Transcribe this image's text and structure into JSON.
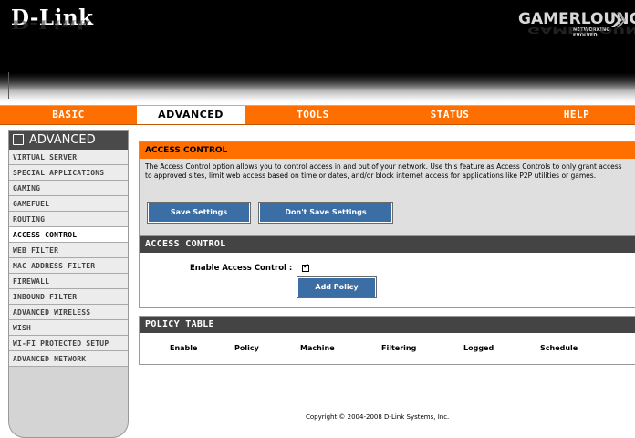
{
  "header": {
    "brand": "D-Link",
    "game_logo": "GAMERLOUNGE",
    "game_logo_sub": "NETWORKING EVOLVED"
  },
  "nav": {
    "tabs": [
      {
        "label": "BASIC"
      },
      {
        "label": "ADVANCED"
      },
      {
        "label": "TOOLS"
      },
      {
        "label": "STATUS"
      },
      {
        "label": "HELP"
      }
    ]
  },
  "sidebar": {
    "heading": "ADVANCED",
    "items": [
      {
        "label": "VIRTUAL SERVER"
      },
      {
        "label": "SPECIAL APPLICATIONS"
      },
      {
        "label": "GAMING"
      },
      {
        "label": "GAMEFUEL"
      },
      {
        "label": "ROUTING"
      },
      {
        "label": "ACCESS CONTROL"
      },
      {
        "label": "WEB FILTER"
      },
      {
        "label": "MAC ADDRESS FILTER"
      },
      {
        "label": "FIREWALL"
      },
      {
        "label": "INBOUND FILTER"
      },
      {
        "label": "ADVANCED WIRELESS"
      },
      {
        "label": "WISH"
      },
      {
        "label": "WI-FI PROTECTED SETUP"
      },
      {
        "label": "ADVANCED NETWORK"
      }
    ]
  },
  "intro": {
    "title": "ACCESS CONTROL",
    "description": "The Access Control option allows you to control access in and out of your network. Use this feature as Access Controls to only grant access to approved sites, limit web access based on time or dates, and/or block internet access for applications like P2P utilities or games.",
    "save_label": "Save Settings",
    "dont_save_label": "Don't Save Settings"
  },
  "access": {
    "title": "ACCESS CONTROL",
    "enable_label": "Enable Access Control :",
    "add_policy_label": "Add Policy"
  },
  "policy_table": {
    "title": "POLICY TABLE",
    "columns": [
      "Enable",
      "Policy",
      "Machine",
      "Filtering",
      "Logged",
      "Schedule"
    ]
  },
  "footer": {
    "copyright": "Copyright © 2004-2008 D-Link Systems, Inc."
  }
}
